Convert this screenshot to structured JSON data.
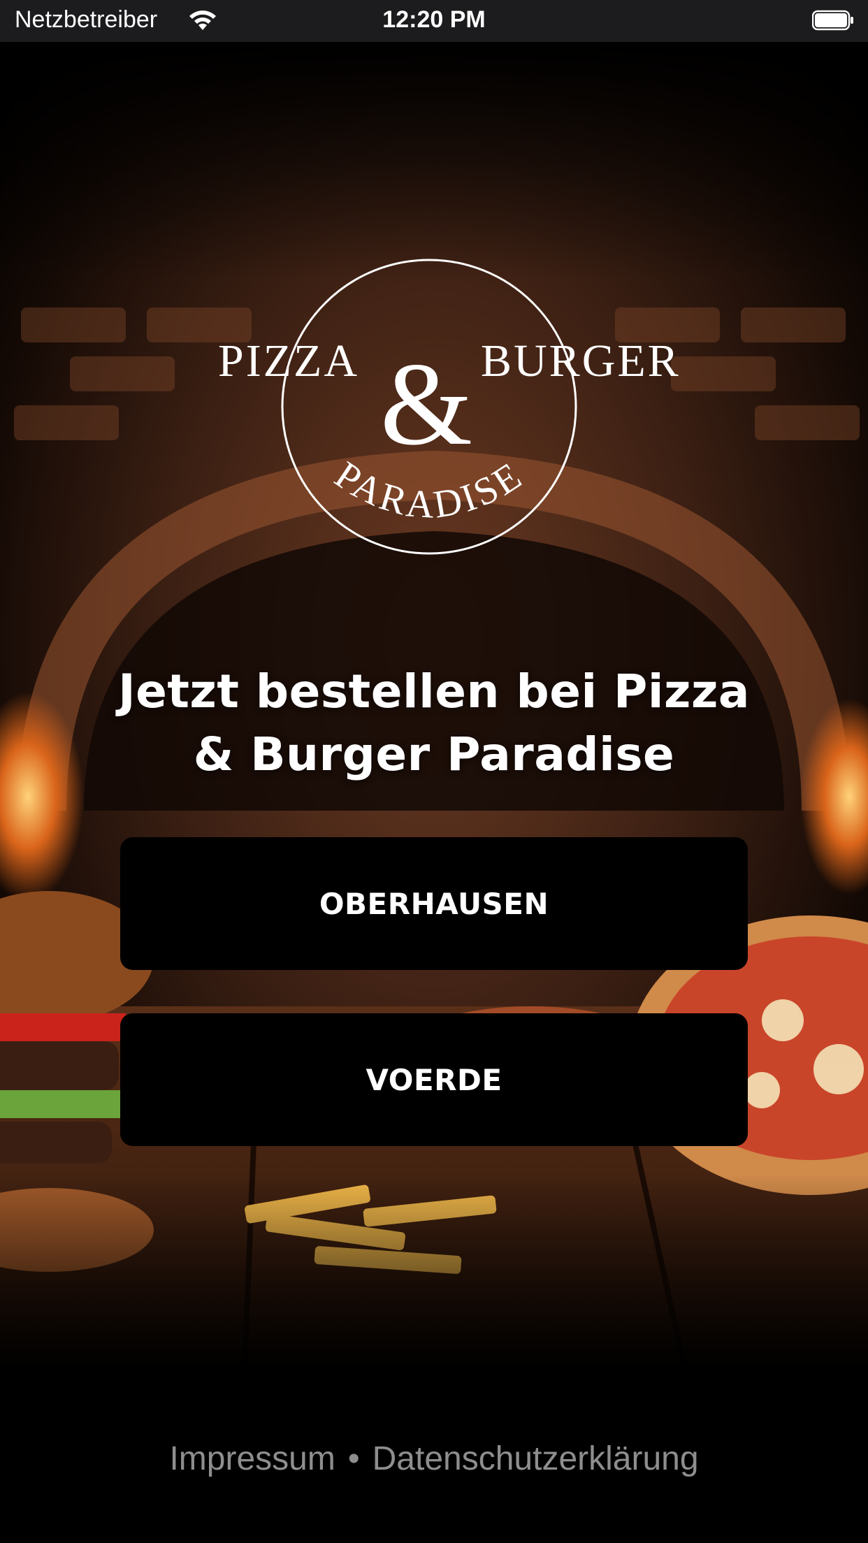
{
  "status_bar": {
    "carrier": "Netzbetreiber",
    "time": "12:20 PM"
  },
  "logo": {
    "text_left": "PIZZA",
    "ampersand": "&",
    "text_right": "BURGER",
    "text_bottom": "PARADISE"
  },
  "headline": {
    "line1": "Jetzt bestellen bei Pizza",
    "line2": "& Burger Paradise"
  },
  "locations": [
    {
      "label": "OBERHAUSEN"
    },
    {
      "label": "VOERDE"
    }
  ],
  "footer": {
    "impressum": "Impressum",
    "separator": "•",
    "datenschutz": "Datenschutzerklärung"
  },
  "colors": {
    "background": "#000000",
    "button": "#000000",
    "button_text": "#ffffff",
    "footer_text": "#8e8e8e"
  }
}
